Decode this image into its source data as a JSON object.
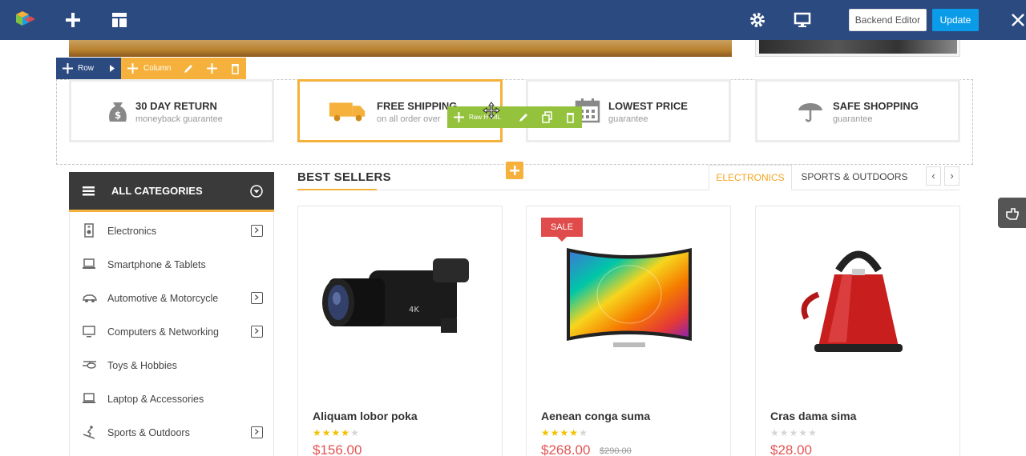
{
  "editor": {
    "backend_label": "Backend Editor",
    "update_label": "Update",
    "row_label": "Row",
    "column_label": "Column",
    "element_label": "Raw HTML"
  },
  "features": [
    {
      "title": "30 DAY RETURN",
      "sub": "moneyback guarantee",
      "icon": "money-bag-icon"
    },
    {
      "title": "FREE SHIPPING",
      "sub": "on all order over",
      "icon": "truck-icon"
    },
    {
      "title": "LOWEST PRICE",
      "sub": "guarantee",
      "icon": "calendar-icon"
    },
    {
      "title": "SAFE SHOPPING",
      "sub": "guarantee",
      "icon": "umbrella-icon"
    }
  ],
  "categories": {
    "title": "ALL CATEGORIES",
    "items": [
      {
        "label": "Electronics",
        "has_sub": true
      },
      {
        "label": "Smartphone & Tablets",
        "has_sub": false
      },
      {
        "label": "Automotive & Motorcycle",
        "has_sub": true
      },
      {
        "label": "Computers & Networking",
        "has_sub": true
      },
      {
        "label": "Toys & Hobbies",
        "has_sub": false
      },
      {
        "label": "Laptop & Accessories",
        "has_sub": false
      },
      {
        "label": "Sports & Outdoors",
        "has_sub": true
      }
    ]
  },
  "best_sellers": {
    "title": "BEST SELLERS",
    "tabs": [
      "ELECTRONICS",
      "SPORTS & OUTDOORS"
    ],
    "prev": "‹",
    "next": "›"
  },
  "products": [
    {
      "name": "Aliquam lobor poka",
      "stars": "★★★★★",
      "rating": 4,
      "price": "$156.00",
      "old_price": "",
      "sale": ""
    },
    {
      "name": "Aenean conga suma",
      "stars": "★★★★★",
      "rating": 4,
      "price": "$268.00",
      "old_price": "$290.00",
      "sale": "SALE"
    },
    {
      "name": "Cras dama sima",
      "stars": "★★★★★",
      "rating": 0,
      "price": "$28.00",
      "old_price": "",
      "sale": ""
    }
  ],
  "colors": {
    "accent": "#f5b13b",
    "topbar": "#2b4a80",
    "price": "#e35454",
    "element": "#95c23d"
  }
}
